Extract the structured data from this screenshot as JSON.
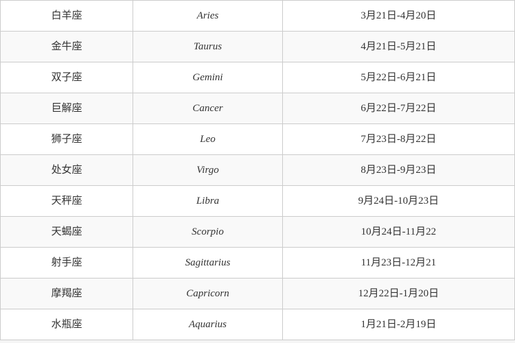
{
  "table": {
    "rows": [
      {
        "chinese": "白羊座",
        "english": "Aries",
        "dates": "3月21日-4月20日"
      },
      {
        "chinese": "金牛座",
        "english": "Taurus",
        "dates": "4月21日-5月21日"
      },
      {
        "chinese": "双子座",
        "english": "Gemini",
        "dates": "5月22日-6月21日"
      },
      {
        "chinese": "巨解座",
        "english": "Cancer",
        "dates": "6月22日-7月22日"
      },
      {
        "chinese": "狮子座",
        "english": "Leo",
        "dates": "7月23日-8月22日"
      },
      {
        "chinese": "处女座",
        "english": "Virgo",
        "dates": "8月23日-9月23日"
      },
      {
        "chinese": "天秤座",
        "english": "Libra",
        "dates": "9月24日-10月23日"
      },
      {
        "chinese": "天蝎座",
        "english": "Scorpio",
        "dates": "10月24日-11月22"
      },
      {
        "chinese": "射手座",
        "english": "Sagittarius",
        "dates": "11月23日-12月21"
      },
      {
        "chinese": "摩羯座",
        "english": "Capricorn",
        "dates": "12月22日-1月20日"
      },
      {
        "chinese": "水瓶座",
        "english": "Aquarius",
        "dates": "1月21日-2月19日"
      }
    ]
  }
}
